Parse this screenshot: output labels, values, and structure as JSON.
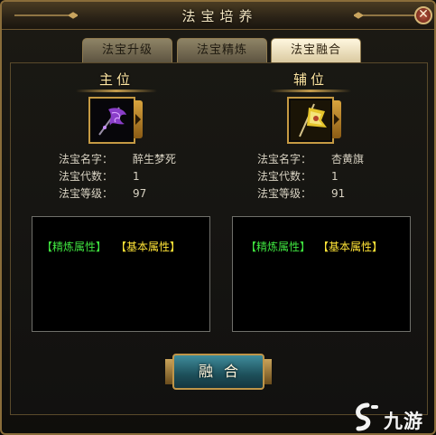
{
  "window": {
    "title": "法宝培养",
    "close_glyph": "✕"
  },
  "tabs": [
    {
      "label": "法宝升级",
      "active": false
    },
    {
      "label": "法宝精炼",
      "active": false
    },
    {
      "label": "法宝融合",
      "active": true
    }
  ],
  "main_slot": {
    "title": "主位",
    "icon": "purple-banner-icon",
    "name_label": "法宝名字：",
    "name": "醉生梦死",
    "gen_label": "法宝代数：",
    "gen": "1",
    "level_label": "法宝等级：",
    "level": "97",
    "refine_attr": "【精炼属性】",
    "base_attr": "【基本属性】"
  },
  "aux_slot": {
    "title": "辅位",
    "icon": "yellow-banner-icon",
    "name_label": "法宝名字：",
    "name": "杏黄旗",
    "gen_label": "法宝代数：",
    "gen": "1",
    "level_label": "法宝等级：",
    "level": "91",
    "refine_attr": "【精炼属性】",
    "base_attr": "【基本属性】"
  },
  "fuse_button": {
    "label": "融合"
  },
  "watermark": {
    "text": "九游",
    "icon": "s-logo-icon"
  },
  "colors": {
    "refine": "#3fe33f",
    "base": "#ffe437",
    "frame": "#8a6d3a",
    "title_text": "#f3e6c2"
  }
}
